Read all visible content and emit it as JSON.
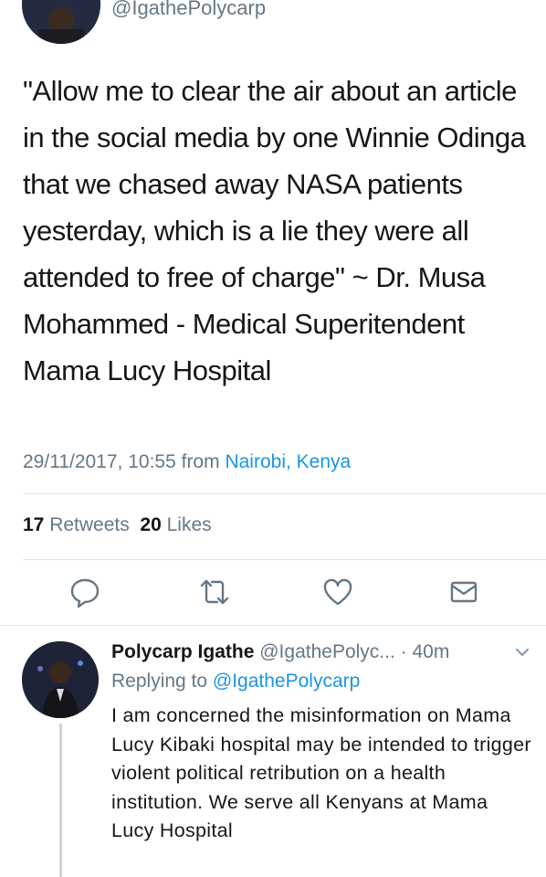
{
  "top_tweet": {
    "handle": "@IgathePolycarp",
    "text": "\"Allow me to clear the air about an article in the social media by one Winnie Odinga that we chased away NASA patients yesterday, which is a lie they were all attended to free of charge\" ~ Dr. Musa Mohammed - Medical Superitendent Mama Lucy Hospital",
    "timestamp": "29/11/2017, 10:55",
    "from_label": "from",
    "location": "Nairobi, Kenya",
    "retweets_count": "17",
    "retweets_label": "Retweets",
    "likes_count": "20",
    "likes_label": "Likes"
  },
  "actions": {
    "reply_icon": "reply-icon",
    "retweet_icon": "retweet-icon",
    "like_icon": "heart-icon",
    "dm_icon": "envelope-icon"
  },
  "reply_tweet": {
    "name": "Polycarp Igathe",
    "handle": "@IgathePolyc...",
    "time": "· 40m",
    "replying_label": "Replying to",
    "replying_to": "@IgathePolycarp",
    "text": "I am concerned the misinformation on Mama Lucy Kibaki hospital may be intended to trigger violent political retribution on a health institution. We serve all Kenyans at Mama Lucy Hospital"
  },
  "colors": {
    "link": "#1b95e0",
    "muted": "#657786",
    "text": "#14171a",
    "divider": "#e1e8ed"
  }
}
